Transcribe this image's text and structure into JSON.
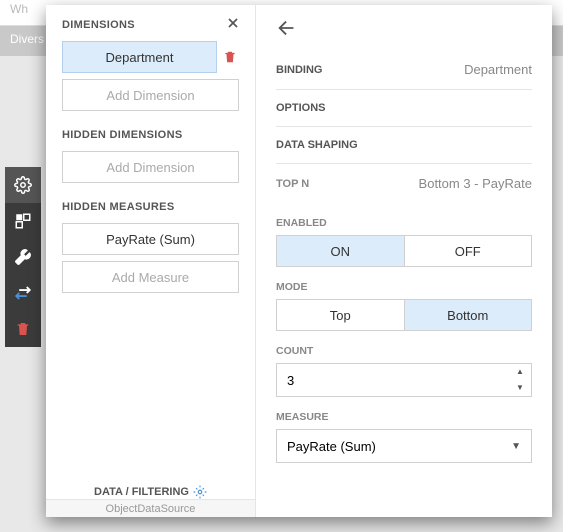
{
  "bg": {
    "header_text": "Wh",
    "gray_text": "Divers"
  },
  "left": {
    "dimensions_title": "DIMENSIONS",
    "dimension_item": "Department",
    "add_dimension": "Add Dimension",
    "hidden_dimensions_title": "HIDDEN DIMENSIONS",
    "hidden_measures_title": "HIDDEN MEASURES",
    "measure_item": "PayRate (Sum)",
    "add_measure": "Add Measure",
    "footer_label": "DATA / FILTERING",
    "source_label": "ObjectDataSource"
  },
  "right": {
    "binding_label": "BINDING",
    "binding_value": "Department",
    "options_label": "OPTIONS",
    "shaping_label": "DATA SHAPING",
    "topn_label": "TOP N",
    "topn_value": "Bottom 3 - PayRate",
    "enabled_label": "ENABLED",
    "enabled_on": "ON",
    "enabled_off": "OFF",
    "mode_label": "MODE",
    "mode_top": "Top",
    "mode_bottom": "Bottom",
    "count_label": "COUNT",
    "count_value": "3",
    "measure_label": "MEASURE",
    "measure_value": "PayRate (Sum)"
  }
}
